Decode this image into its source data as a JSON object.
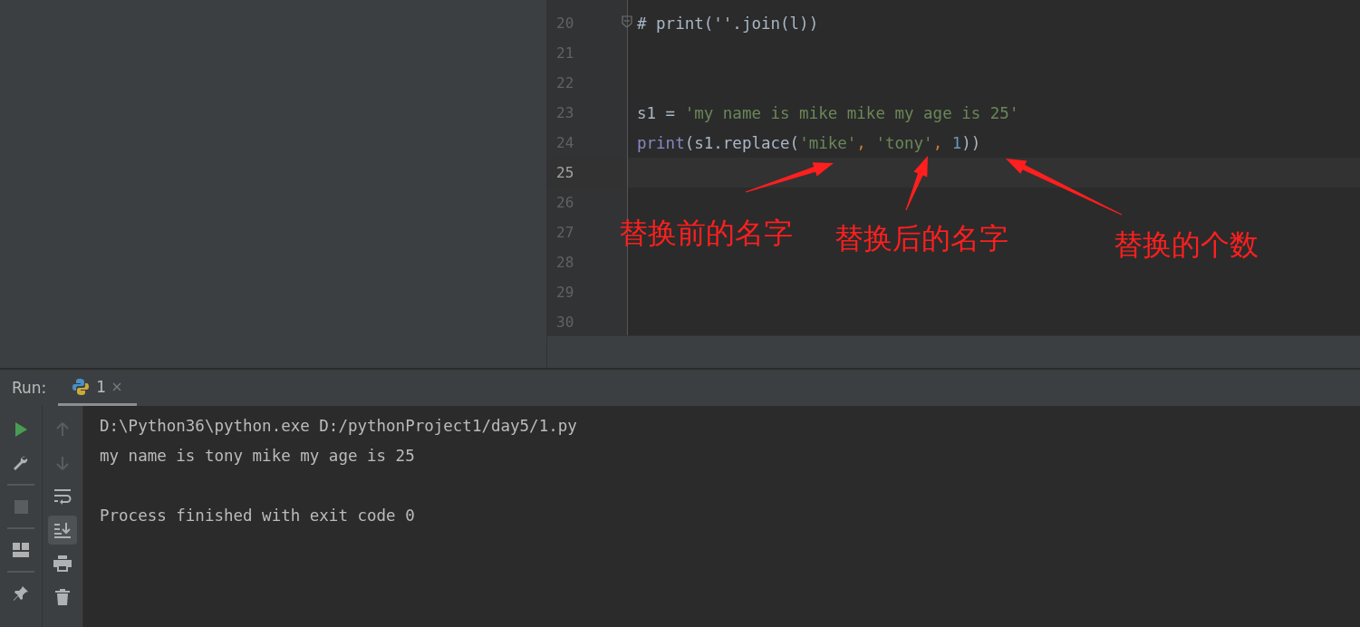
{
  "editor": {
    "lines": [
      {
        "number": "20",
        "current": false,
        "fold": true,
        "tokens": [
          {
            "kind": "comment",
            "text": "# print(''.join(l))"
          }
        ]
      },
      {
        "number": "21",
        "current": false,
        "fold": false
      },
      {
        "number": "22",
        "current": false,
        "fold": false
      },
      {
        "number": "23",
        "current": false,
        "fold": false,
        "tokens": [
          {
            "kind": "plain",
            "text": "s1 = "
          },
          {
            "kind": "string",
            "text": "'my name is mike mike my age is 25'"
          }
        ]
      },
      {
        "number": "24",
        "current": false,
        "fold": false,
        "tokens": [
          {
            "kind": "builtin",
            "text": "print"
          },
          {
            "kind": "plain",
            "text": "(s1.replace("
          },
          {
            "kind": "string",
            "text": "'mike'"
          },
          {
            "kind": "comma",
            "text": ", "
          },
          {
            "kind": "string",
            "text": "'tony'"
          },
          {
            "kind": "comma",
            "text": ", "
          },
          {
            "kind": "number",
            "text": "1"
          },
          {
            "kind": "plain",
            "text": "))"
          }
        ]
      },
      {
        "number": "25",
        "current": true,
        "fold": false
      },
      {
        "number": "26",
        "current": false,
        "fold": false
      },
      {
        "number": "27",
        "current": false,
        "fold": false
      },
      {
        "number": "28",
        "current": false,
        "fold": false
      },
      {
        "number": "29",
        "current": false,
        "fold": false
      },
      {
        "number": "30",
        "current": false,
        "fold": false
      }
    ]
  },
  "annotations": [
    {
      "label": "替换前的名字"
    },
    {
      "label": "替换后的名字"
    },
    {
      "label": "替换的个数"
    }
  ],
  "run_panel": {
    "title": "Run:",
    "tabs": [
      {
        "label": "1",
        "selected": true
      }
    ],
    "left_toolbar": [
      {
        "kind": "run",
        "disabled": false
      },
      {
        "kind": "wrench",
        "disabled": false
      },
      {
        "kind": "separator"
      },
      {
        "kind": "stop",
        "disabled": true
      },
      {
        "kind": "separator"
      },
      {
        "kind": "layout",
        "disabled": false
      },
      {
        "kind": "separator"
      },
      {
        "kind": "pin",
        "disabled": false
      }
    ],
    "right_toolbar": [
      {
        "kind": "up",
        "disabled": true,
        "selected": false
      },
      {
        "kind": "down",
        "disabled": true,
        "selected": false
      },
      {
        "kind": "wrap",
        "disabled": false,
        "selected": false
      },
      {
        "kind": "scroll-end",
        "disabled": false,
        "selected": true
      },
      {
        "kind": "print",
        "disabled": false,
        "selected": false
      },
      {
        "kind": "trash",
        "disabled": false,
        "selected": false
      }
    ],
    "console": [
      {
        "kind": "command",
        "text": "D:\\Python36\\python.exe D:/pythonProject1/day5/1.py"
      },
      {
        "kind": "output",
        "text": "my name is tony mike my age is 25"
      },
      {
        "kind": "exit",
        "text": "Process finished with exit code 0"
      }
    ]
  }
}
